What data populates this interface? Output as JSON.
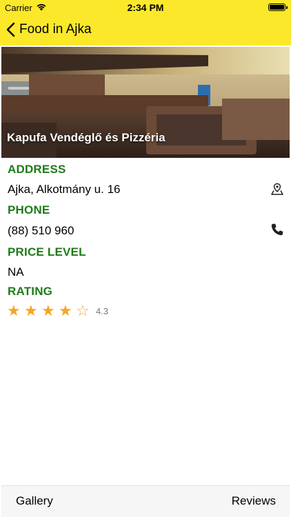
{
  "status_bar": {
    "carrier": "Carrier",
    "time": "2:34 PM"
  },
  "nav": {
    "back_label": "Food in Ajka",
    "bar_color": "#fce82a"
  },
  "restaurant": {
    "name": "Kapufa Vendéglő és Pizzéria"
  },
  "details": {
    "address_label": "ADDRESS",
    "address_value": "Ajka, Alkotmány u. 16",
    "phone_label": "PHONE",
    "phone_value": "(88) 510 960",
    "price_label": "PRICE LEVEL",
    "price_value": "NA",
    "rating_label": "RATING",
    "rating_value": "4.3",
    "rating_stars_filled": 4,
    "rating_stars_total": 5,
    "label_color": "#1f7a1a",
    "star_color": "#f5a623"
  },
  "tabs": {
    "gallery": "Gallery",
    "reviews": "Reviews"
  }
}
